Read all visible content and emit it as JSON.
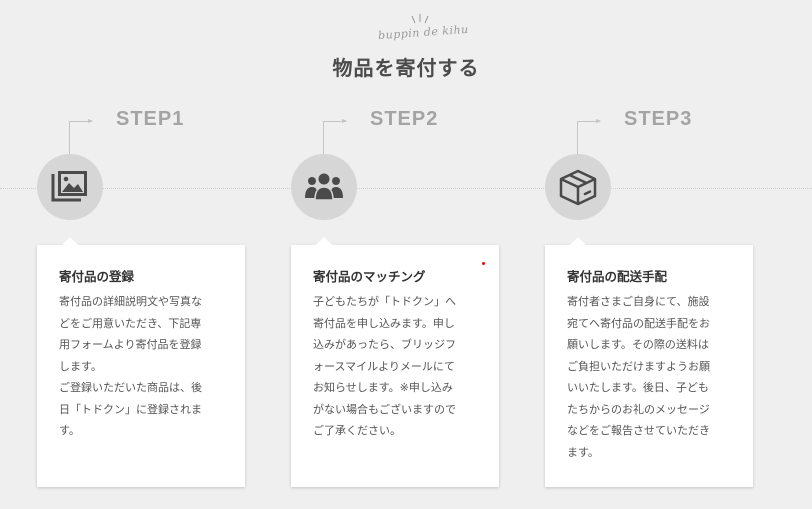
{
  "header": {
    "script_text": "buppin de kihu",
    "title": "物品を寄付する"
  },
  "steps": [
    {
      "label": "STEP1",
      "icon": "images-icon",
      "card_title": "寄付品の登録",
      "card_lines": [
        "寄付品の詳細説明文や写真な",
        "どをご用意いただき、下記専",
        "用フォームより寄付品を登録",
        "します。",
        "ご登録いただいた商品は、後",
        "日「トドクン」に登録されま",
        "す。"
      ]
    },
    {
      "label": "STEP2",
      "icon": "users-icon",
      "card_title": "寄付品のマッチング",
      "card_lines": [
        "子どもたちが「トドクン」へ",
        "寄付品を申し込みます。申し",
        "込みがあったら、ブリッジフ",
        "ォースマイルよりメールにて",
        "お知らせします。※申し込み",
        "がない場合もございますので",
        "ご了承ください。"
      ]
    },
    {
      "label": "STEP3",
      "icon": "box-icon",
      "card_title": "寄付品の配送手配",
      "card_lines": [
        "寄付者さまご自身にて、施設",
        "宛てへ寄付品の配送手配をお",
        "願いします。その際の送料は",
        "ご負担いただけますようお願",
        "いいたします。後日、子ども",
        "たちからのお礼のメッセージ",
        "などをご報告させていただき",
        "ます。"
      ]
    }
  ]
}
